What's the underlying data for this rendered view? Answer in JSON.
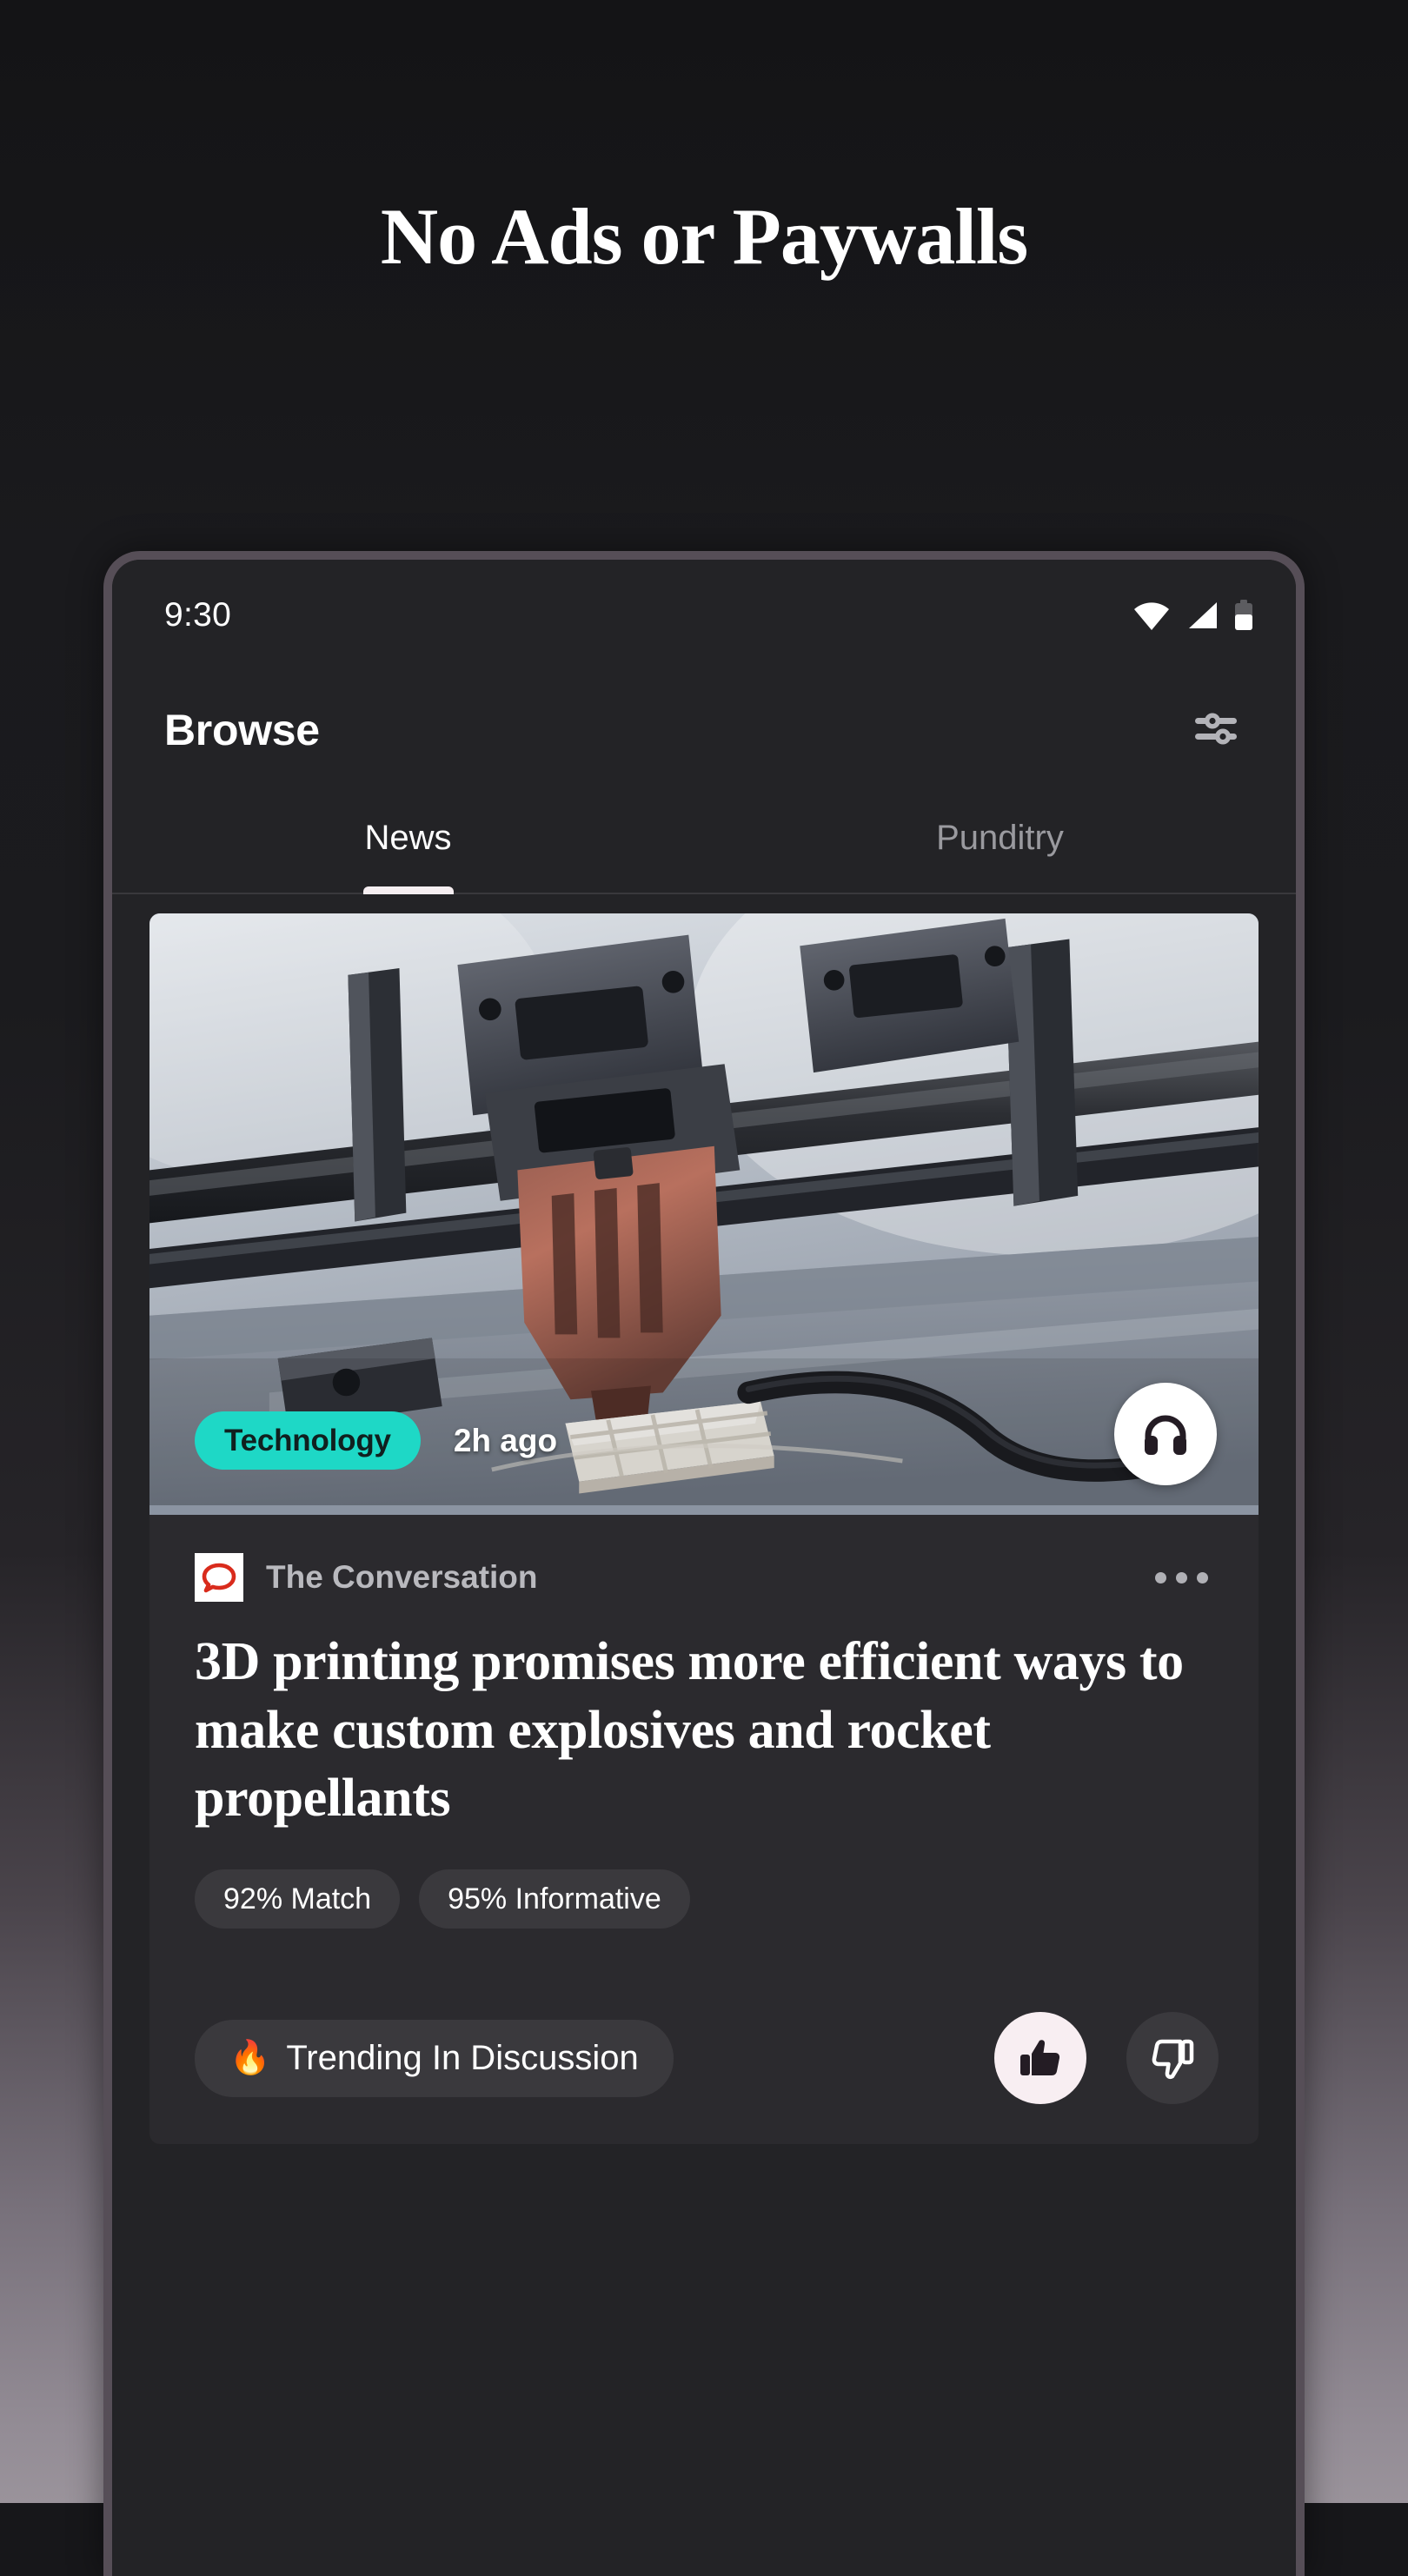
{
  "promo": {
    "headline": "No Ads or Paywalls"
  },
  "phone": {
    "status_bar": {
      "time": "9:30",
      "icons": [
        "wifi-icon",
        "cellular-signal-icon",
        "battery-icon"
      ]
    },
    "app_bar": {
      "title": "Browse",
      "filter_icon": "tune-sliders-icon"
    },
    "tabs": [
      {
        "label": "News",
        "active": true
      },
      {
        "label": "Punditry",
        "active": false
      }
    ],
    "card": {
      "hero": {
        "category": "Technology",
        "time_ago": "2h ago",
        "listen_icon": "headphones-icon",
        "alt": "3D printer extruder printing a white lattice part on a print bed"
      },
      "source": {
        "name": "The Conversation",
        "logo_icon": "speech-bubble-icon",
        "logo_color": "#d92b1c",
        "more_icon": "more-horizontal-icon"
      },
      "title": "3D printing promises more efficient ways to make custom explosives and rocket propellants",
      "chips": [
        "92% Match",
        "95% Informative"
      ],
      "footer": {
        "trending_emoji": "🔥",
        "trending_label": "Trending In Discussion",
        "like_icon": "thumbs-up-icon",
        "dislike_icon": "thumbs-down-icon",
        "like_active": true
      }
    }
  },
  "colors": {
    "accent_teal": "#1ED8C6",
    "card_bg": "#2B2A2E",
    "chip_bg": "#3A393D",
    "like_bg": "#F8EEF2",
    "screen_bg": "#232326",
    "bezel": "#564E57"
  }
}
